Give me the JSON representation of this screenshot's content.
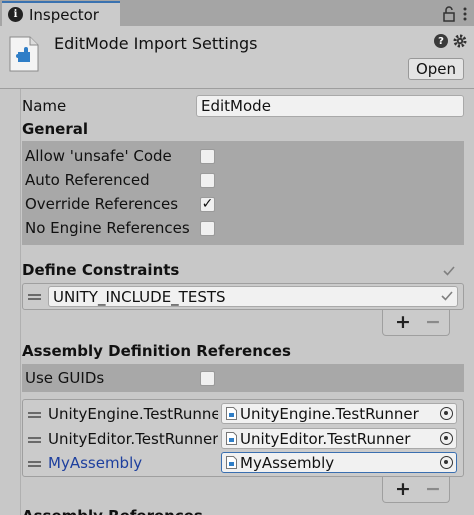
{
  "tab": {
    "title": "Inspector",
    "icon": "info-icon"
  },
  "header": {
    "title": "EditMode Import Settings",
    "open_label": "Open"
  },
  "name_row": {
    "label": "Name",
    "value": "EditMode"
  },
  "general": {
    "heading": "General",
    "options": [
      {
        "label": "Allow 'unsafe' Code",
        "checked": false
      },
      {
        "label": "Auto Referenced",
        "checked": false
      },
      {
        "label": "Override References",
        "checked": true
      },
      {
        "label": "No Engine References",
        "checked": false
      }
    ]
  },
  "define_constraints": {
    "heading": "Define Constraints",
    "items": [
      {
        "value": "UNITY_INCLUDE_TESTS"
      }
    ],
    "add_label": "+",
    "remove_label": "−"
  },
  "assembly_refs": {
    "heading": "Assembly Definition References",
    "use_guids": {
      "label": "Use GUIDs",
      "checked": false
    },
    "items": [
      {
        "label": "UnityEngine.TestRunner",
        "value": "UnityEngine.TestRunner"
      },
      {
        "label": "UnityEditor.TestRunner",
        "value": "UnityEditor.TestRunner"
      },
      {
        "label": "MyAssembly",
        "value": "MyAssembly"
      }
    ],
    "add_label": "+",
    "remove_label": "−"
  },
  "next_heading": "Assembly References",
  "colors": {
    "accent": "#3a72b0",
    "link_blue": "#1d3f9e",
    "panel": "#a8a8a8",
    "background": "#c8c8c8"
  }
}
